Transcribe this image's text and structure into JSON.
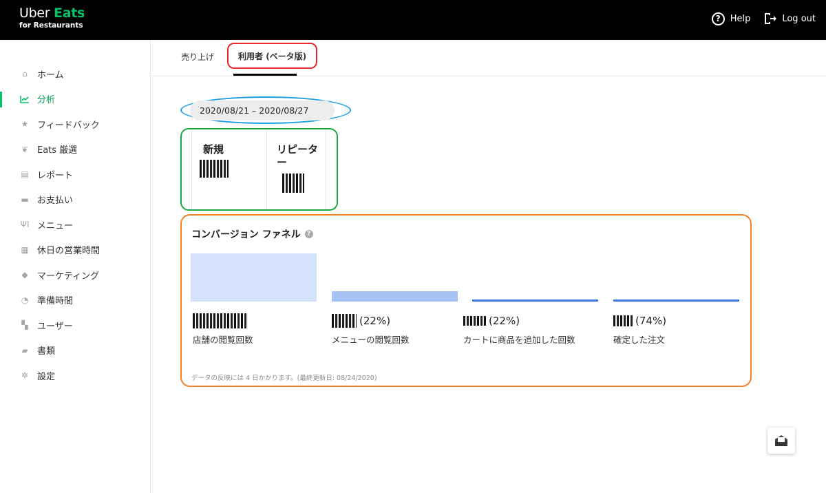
{
  "header": {
    "logo_line1_a": "Uber ",
    "logo_line1_b": "Eats",
    "logo_line2": "for Restaurants",
    "help_label": "Help",
    "logout_label": "Log out"
  },
  "sidebar": {
    "items": [
      {
        "label": "ホーム",
        "icon": "home-icon"
      },
      {
        "label": "分析",
        "icon": "chart-icon",
        "active": true
      },
      {
        "label": "フィードバック",
        "icon": "star-icon"
      },
      {
        "label": "Eats 厳選",
        "icon": "award-icon"
      },
      {
        "label": "レポート",
        "icon": "report-icon"
      },
      {
        "label": "お支払い",
        "icon": "card-icon"
      },
      {
        "label": "メニュー",
        "icon": "cutlery-icon"
      },
      {
        "label": "休日の営業時間",
        "icon": "calendar-icon"
      },
      {
        "label": "マーケティング",
        "icon": "tag-icon"
      },
      {
        "label": "準備時間",
        "icon": "timer-icon"
      },
      {
        "label": "ユーザー",
        "icon": "users-icon"
      },
      {
        "label": "書類",
        "icon": "folder-icon"
      },
      {
        "label": "設定",
        "icon": "gear-icon"
      }
    ]
  },
  "tabs": [
    {
      "label": "売り上げ"
    },
    {
      "label": "利用者 (ベータ版)",
      "active": true
    }
  ],
  "date_range": "2020/08/21 – 2020/08/27",
  "stats": {
    "new_label": "新規",
    "repeat_label": "リピーター"
  },
  "funnel": {
    "title": "コンバージョン ファネル",
    "help_glyph": "?",
    "steps": [
      {
        "label": "店舗の閲覧回数",
        "pct": ""
      },
      {
        "label": "メニューの閲覧回数",
        "pct": "(22%)"
      },
      {
        "label": "カートに商品を追加した回数",
        "pct": "(22%)"
      },
      {
        "label": "確定した注文",
        "pct": "(74%)"
      }
    ],
    "note": "データの反映には 4 日かかります。(最終更新日: 08/24/2020)"
  },
  "colors": {
    "brand_green": "#06c167",
    "bar_light": "#d4e3fb",
    "bar_mid": "#a4c3f4",
    "bar_dark": "#3a78e0"
  }
}
